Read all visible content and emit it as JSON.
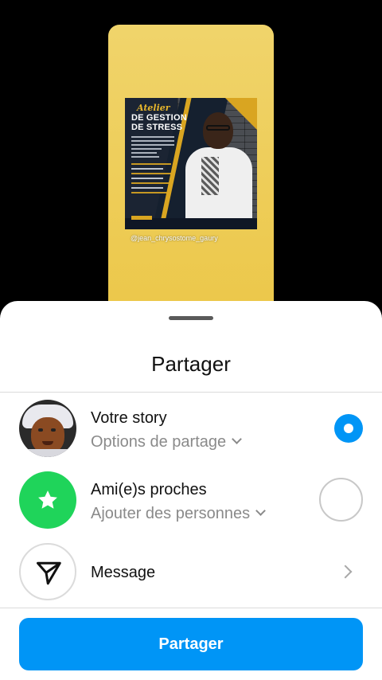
{
  "story_preview": {
    "flyer": {
      "title_script": "Atelier",
      "title_line1": "DE GESTION",
      "title_line2": "DE STRESS"
    },
    "handle": "@jean_chrysostome_gaury"
  },
  "sheet": {
    "title": "Partager",
    "options": [
      {
        "label": "Votre story",
        "sub": "Options de partage",
        "selected": true
      },
      {
        "label": "Ami(e)s proches",
        "sub": "Ajouter des personnes",
        "selected": false
      },
      {
        "label": "Message"
      }
    ],
    "share_button": "Partager"
  },
  "colors": {
    "accent": "#0095f6",
    "close_friends": "#1fd45a",
    "story_bg": "#ecc749"
  },
  "icons": {
    "close_friends": "star-icon",
    "message": "send-icon",
    "dropdown": "chevron-down-icon",
    "forward": "chevron-right-icon"
  }
}
